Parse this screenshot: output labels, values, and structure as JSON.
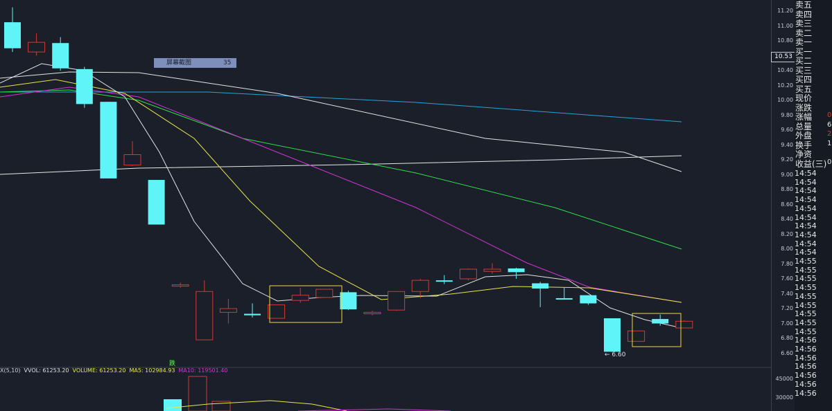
{
  "colors": {
    "background": "#1b1f2a",
    "up": "#d23b35",
    "down": "#5ff4f7",
    "ma5": "#e4e4e4",
    "ma10": "#e8e84a",
    "ma20": "#d433d6",
    "ma30": "#2ee04a",
    "ma60": "#2aa3d6",
    "ma120": "#e8e8e8",
    "highlight": "#f1d93a"
  },
  "chart_data": {
    "type": "candlestick",
    "y_axis_ticks": [
      "11.20",
      "11.00",
      "10.80",
      "10.60",
      "10.40",
      "10.20",
      "10.00",
      "9.80",
      "9.60",
      "9.40",
      "9.20",
      "9.00",
      "8.80",
      "8.60",
      "8.40",
      "8.20",
      "8.00",
      "7.80",
      "7.60",
      "7.40",
      "7.20",
      "7.00",
      "6.80",
      "6.60"
    ],
    "volume_axis_ticks": [
      "45000",
      "30000"
    ],
    "current_price": "10.53",
    "candles": [
      {
        "o": 11.05,
        "c": 10.7,
        "h": 11.25,
        "l": 10.65
      },
      {
        "o": 10.65,
        "c": 10.78,
        "h": 10.9,
        "l": 10.6
      },
      {
        "o": 10.77,
        "c": 10.43,
        "h": 10.85,
        "l": 10.4
      },
      {
        "o": 10.42,
        "c": 9.95,
        "h": 10.45,
        "l": 9.9
      },
      {
        "o": 9.98,
        "c": 8.95,
        "h": 9.98,
        "l": 8.95
      },
      {
        "o": 9.13,
        "c": 9.27,
        "h": 9.45,
        "l": 9.12
      },
      {
        "o": 8.93,
        "c": 8.33,
        "h": 8.93,
        "l": 8.33
      },
      {
        "o": 7.52,
        "c": 7.52,
        "h": 7.55,
        "l": 7.48
      },
      {
        "o": 6.78,
        "c": 7.43,
        "h": 7.58,
        "l": 6.78
      },
      {
        "o": 7.15,
        "c": 7.2,
        "h": 7.33,
        "l": 7.0
      },
      {
        "o": 7.13,
        "c": 7.11,
        "h": 7.27,
        "l": 7.08
      },
      {
        "o": 7.07,
        "c": 7.25,
        "h": 7.25,
        "l": 7.07
      },
      {
        "o": 7.31,
        "c": 7.38,
        "h": 7.48,
        "l": 7.28
      },
      {
        "o": 7.35,
        "c": 7.46,
        "h": 7.46,
        "l": 7.35
      },
      {
        "o": 7.42,
        "c": 7.19,
        "h": 7.44,
        "l": 7.18
      },
      {
        "o": 7.13,
        "c": 7.15,
        "h": 7.17,
        "l": 7.11
      },
      {
        "o": 7.18,
        "c": 7.43,
        "h": 7.43,
        "l": 7.17
      },
      {
        "o": 7.43,
        "c": 7.58,
        "h": 7.6,
        "l": 7.34
      },
      {
        "o": 7.58,
        "c": 7.57,
        "h": 7.65,
        "l": 7.53
      },
      {
        "o": 7.6,
        "c": 7.73,
        "h": 7.74,
        "l": 7.58
      },
      {
        "o": 7.7,
        "c": 7.73,
        "h": 7.81,
        "l": 7.67
      },
      {
        "o": 7.74,
        "c": 7.69,
        "h": 7.75,
        "l": 7.6
      },
      {
        "o": 7.54,
        "c": 7.47,
        "h": 7.56,
        "l": 7.22
      },
      {
        "o": 7.34,
        "c": 7.33,
        "h": 7.48,
        "l": 7.33
      },
      {
        "o": 7.38,
        "c": 7.27,
        "h": 7.38,
        "l": 7.25
      },
      {
        "o": 7.07,
        "c": 6.62,
        "h": 7.07,
        "l": 6.62
      },
      {
        "o": 6.76,
        "c": 6.9,
        "h": 6.9,
        "l": 6.76
      },
      {
        "o": 7.06,
        "c": 7.0,
        "h": 7.12,
        "l": 6.97
      },
      {
        "o": 6.94,
        "c": 7.03,
        "h": 7.04,
        "l": 6.94
      }
    ],
    "low_marker": "6.60",
    "label": {
      "text": "屏幕截图",
      "value": "35"
    },
    "fall_text": "跌",
    "volume_header": [
      {
        "text": "X(5,10)",
        "color": "#cfd3da"
      },
      {
        "text": "VVOL: 61253.20",
        "color": "#e0e0e0"
      },
      {
        "text": "VOLUME: 61253.20",
        "color": "#e8e84a"
      },
      {
        "text": "MA5: 102984.93",
        "color": "#e8e84a"
      },
      {
        "text": "MA10: 119501.40",
        "color": "#d433d6"
      }
    ]
  },
  "order_book": {
    "labels": [
      "卖五",
      "卖四",
      "卖三",
      "卖二",
      "卖一",
      "买一",
      "买二",
      "买三",
      "买四",
      "买五",
      "现价",
      "涨跌",
      "涨幅",
      "总量",
      "外盘",
      "换手",
      "净资",
      "收益(三)"
    ],
    "partial_values": [
      {
        "row": 12,
        "text": "0",
        "color": "#d23b35"
      },
      {
        "row": 13,
        "text": "6",
        "color": "#e6e6e6"
      },
      {
        "row": 14,
        "text": "2",
        "color": "#d23b35"
      },
      {
        "row": 15,
        "text": "1",
        "color": "#e6e6e6"
      },
      {
        "row": 17,
        "text": "0",
        "color": "#e6e6e6"
      }
    ]
  },
  "trade_times": [
    "14:54",
    "14:54",
    "14:54",
    "14:54",
    "14:54",
    "14:54",
    "14:54",
    "14:54",
    "14:54",
    "14:54",
    "14:55",
    "14:55",
    "14:55",
    "14:55",
    "14:55",
    "14:55",
    "14:55",
    "14:55",
    "14:55",
    "14:56",
    "14:56",
    "14:56",
    "14:56",
    "14:56",
    "14:56",
    "14:56"
  ]
}
